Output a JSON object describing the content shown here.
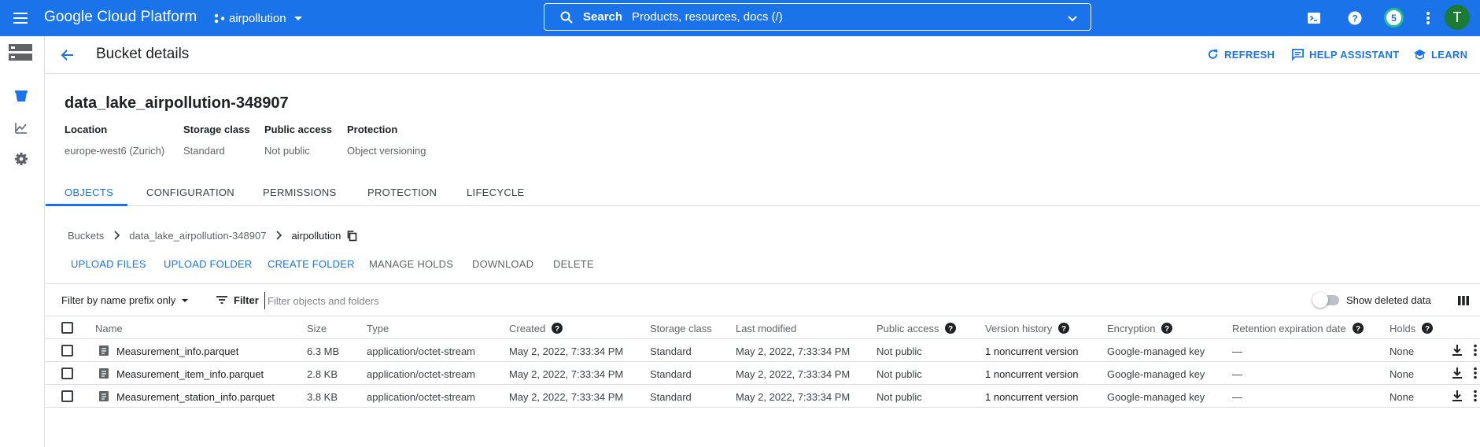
{
  "topbar": {
    "brand": "Google Cloud Platform",
    "project": "airpollution",
    "search_label": "Search",
    "search_placeholder": "Products, resources, docs (/)",
    "notifications_count": "5",
    "avatar_initial": "T"
  },
  "header": {
    "title": "Bucket details",
    "refresh": "REFRESH",
    "help_assistant": "HELP ASSISTANT",
    "learn": "LEARN"
  },
  "bucket": {
    "name": "data_lake_airpollution-348907",
    "meta": [
      {
        "key": "Location",
        "value": "europe-west6 (Zurich)"
      },
      {
        "key": "Storage class",
        "value": "Standard"
      },
      {
        "key": "Public access",
        "value": "Not public"
      },
      {
        "key": "Protection",
        "value": "Object versioning"
      }
    ]
  },
  "tabs": [
    "OBJECTS",
    "CONFIGURATION",
    "PERMISSIONS",
    "PROTECTION",
    "LIFECYCLE"
  ],
  "breadcrumb": [
    "Buckets",
    "data_lake_airpollution-348907",
    "airpollution"
  ],
  "actions": {
    "upload_files": "UPLOAD FILES",
    "upload_folder": "UPLOAD FOLDER",
    "create_folder": "CREATE FOLDER",
    "manage_holds": "MANAGE HOLDS",
    "download": "DOWNLOAD",
    "delete": "DELETE"
  },
  "filterbar": {
    "prefix": "Filter by name prefix only",
    "filter": "Filter",
    "placeholder": "Filter objects and folders",
    "show_deleted": "Show deleted data"
  },
  "table": {
    "columns": [
      "Name",
      "Size",
      "Type",
      "Created",
      "Storage class",
      "Last modified",
      "Public access",
      "Version history",
      "Encryption",
      "Retention expiration date",
      "Holds"
    ],
    "rows": [
      {
        "name": "Measurement_info.parquet",
        "size": "6.3 MB",
        "type": "application/octet-stream",
        "created": "May 2, 2022, 7:33:34 PM",
        "storage": "Standard",
        "modified": "May 2, 2022, 7:33:34 PM",
        "public": "Not public",
        "version": "1 noncurrent version",
        "encryption": "Google-managed key",
        "retention": "—",
        "holds": "None"
      },
      {
        "name": "Measurement_item_info.parquet",
        "size": "2.8 KB",
        "type": "application/octet-stream",
        "created": "May 2, 2022, 7:33:34 PM",
        "storage": "Standard",
        "modified": "May 2, 2022, 7:33:34 PM",
        "public": "Not public",
        "version": "1 noncurrent version",
        "encryption": "Google-managed key",
        "retention": "—",
        "holds": "None"
      },
      {
        "name": "Measurement_station_info.parquet",
        "size": "3.8 KB",
        "type": "application/octet-stream",
        "created": "May 2, 2022, 7:33:34 PM",
        "storage": "Standard",
        "modified": "May 2, 2022, 7:33:34 PM",
        "public": "Not public",
        "version": "1 noncurrent version",
        "encryption": "Google-managed key",
        "retention": "—",
        "holds": "None"
      }
    ]
  },
  "colors": {
    "accent": "#1a73e8",
    "avatar": "#1b7a33",
    "badge_ring": "#1ec08c"
  }
}
